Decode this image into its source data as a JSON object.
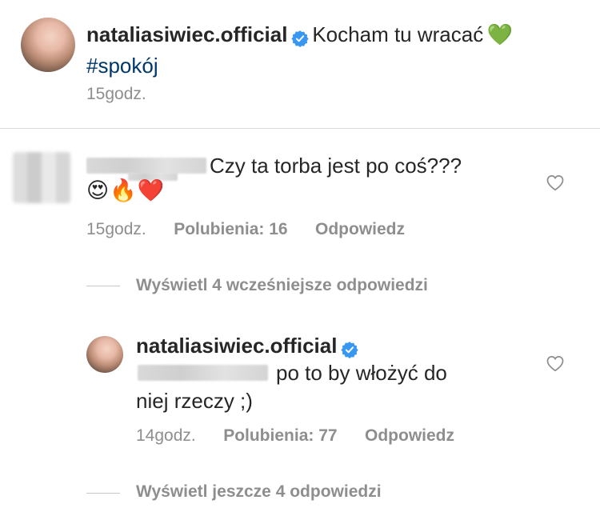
{
  "post": {
    "username": "nataliasiwiec.official",
    "caption": "Kocham tu wracać",
    "caption_emoji": "💚",
    "hashtag": "#spokój",
    "time": "15godz."
  },
  "comment": {
    "text": "Czy ta torba jest po coś???",
    "emojis": "😍🔥❤️",
    "time": "15godz.",
    "likes": "Polubienia: 16",
    "reply": "Odpowiedz",
    "view_earlier": "Wyświetl 4 wcześniejsze odpowiedzi"
  },
  "reply": {
    "username": "nataliasiwiec.official",
    "text_line1": "po to by włożyć do",
    "text_line2": "niej rzeczy ;)",
    "time": "14godz.",
    "likes": "Polubienia: 77",
    "reply": "Odpowiedz",
    "view_more": "Wyświetl jeszcze 4 odpowiedzi"
  },
  "colors": {
    "verified": "#3897f0",
    "hashtag": "#00376b",
    "meta": "#8e8e8e"
  },
  "icons": {
    "verified": "verified-badge-icon",
    "like": "heart-outline-icon"
  }
}
